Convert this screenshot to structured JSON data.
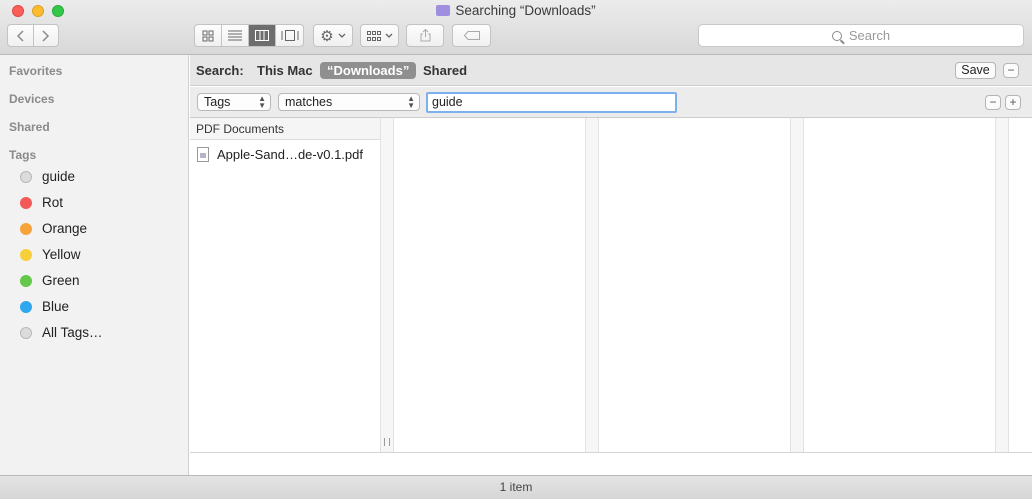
{
  "window": {
    "title": "Searching “Downloads”"
  },
  "toolbar": {
    "search_placeholder": "Search"
  },
  "sidebar": {
    "sections": [
      "Favorites",
      "Devices",
      "Shared",
      "Tags"
    ],
    "tags": [
      {
        "label": "guide",
        "color": "#dcdcdc"
      },
      {
        "label": "Rot",
        "color": "#f35957"
      },
      {
        "label": "Orange",
        "color": "#f7a33b"
      },
      {
        "label": "Yellow",
        "color": "#f7cf3a"
      },
      {
        "label": "Green",
        "color": "#63c84a"
      },
      {
        "label": "Blue",
        "color": "#2fa7f0"
      },
      {
        "label": "All Tags…",
        "color": "#dcdcdc"
      }
    ]
  },
  "scope": {
    "label": "Search:",
    "this_mac": "This Mac",
    "downloads": "“Downloads”",
    "shared": "Shared",
    "save": "Save",
    "minus": "−"
  },
  "criteria": {
    "attribute": "Tags",
    "operator": "matches",
    "value": "guide",
    "minus": "−",
    "plus": "+"
  },
  "results": {
    "group_header": "PDF Documents",
    "files": [
      "Apple-Sand…de-v0.1.pdf"
    ]
  },
  "status": {
    "text": "1 item"
  }
}
